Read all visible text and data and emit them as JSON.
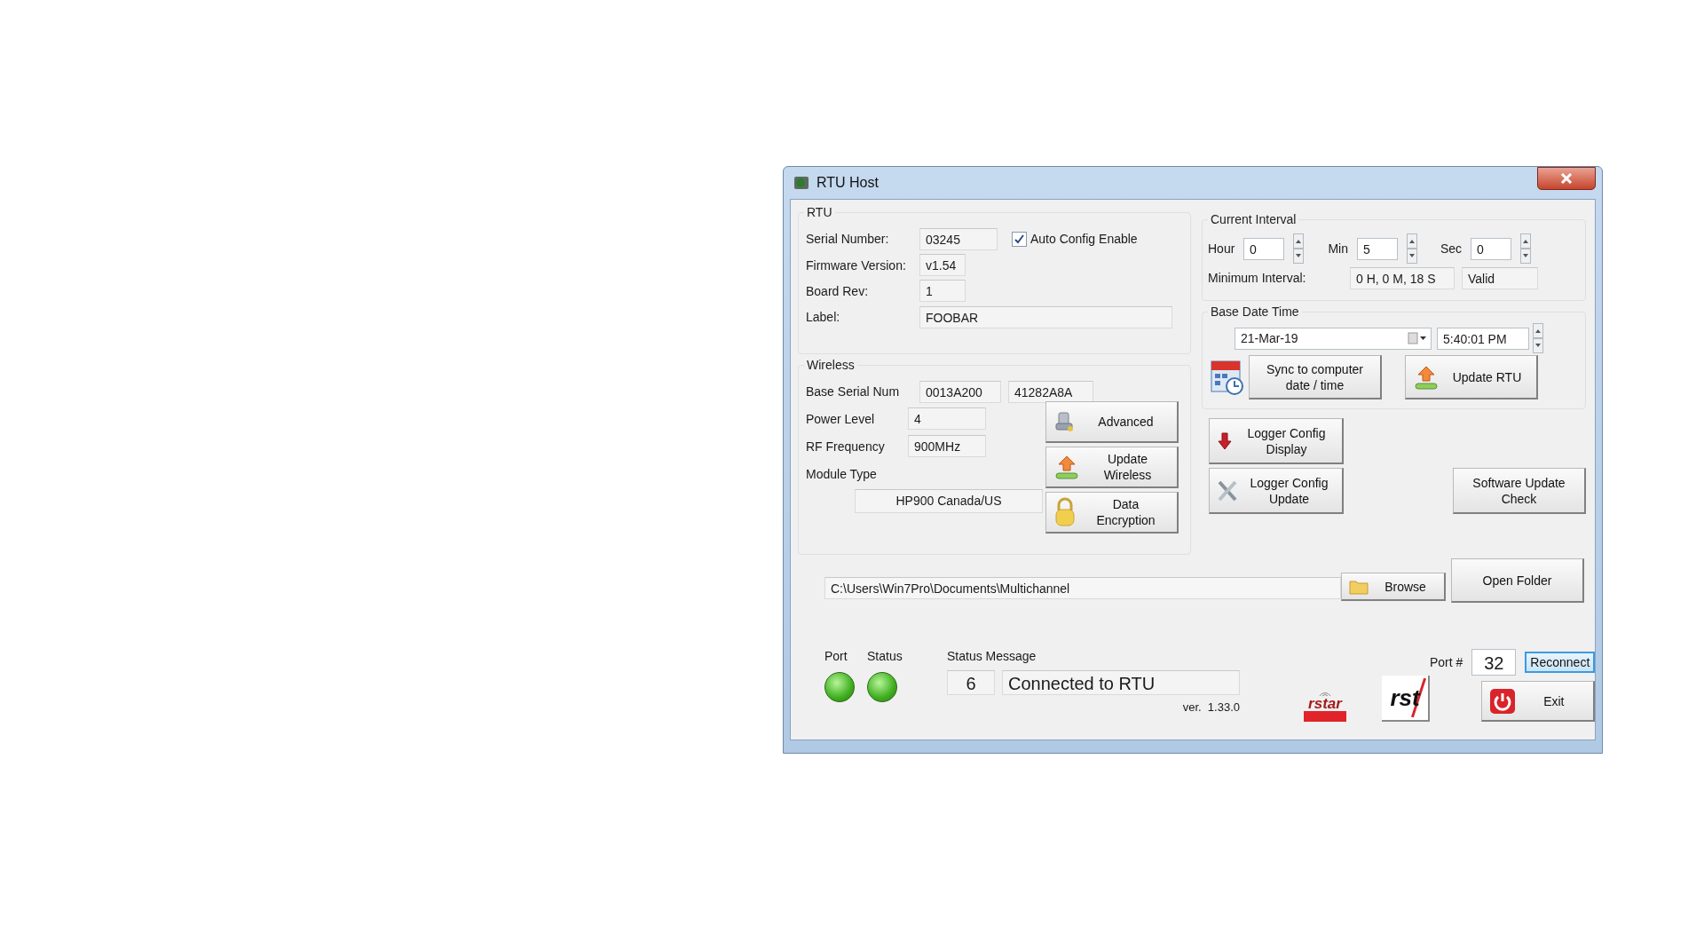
{
  "window": {
    "title": "RTU Host"
  },
  "rtu": {
    "title": "RTU",
    "serial_number": {
      "label": "Serial Number:",
      "value": "03245"
    },
    "auto_config": {
      "label": "Auto Config Enable",
      "checked": true
    },
    "firmware_version": {
      "label": "Firmware Version:",
      "value": "v1.54"
    },
    "board_rev": {
      "label": "Board Rev:",
      "value": "1"
    },
    "label": {
      "label": "Label:",
      "value": "FOOBAR"
    }
  },
  "wireless": {
    "title": "Wireless",
    "base_serial": {
      "label": "Base Serial Num",
      "values": [
        "0013A200",
        "41282A8A"
      ]
    },
    "power_level": {
      "label": "Power Level",
      "value": "4"
    },
    "rf_frequency": {
      "label": "RF Frequency",
      "value": "900MHz"
    },
    "module_type": {
      "label": "Module Type",
      "value": "HP900 Canada/US"
    },
    "buttons": [
      {
        "label": "Advanced"
      },
      {
        "label": "Update\nWireless"
      },
      {
        "label": "Data\nEncryption"
      }
    ]
  },
  "current_interval": {
    "title": "Current Interval",
    "fields": [
      {
        "label": "Hour",
        "value": "0"
      },
      {
        "label": "Min",
        "value": "5"
      },
      {
        "label": "Sec",
        "value": "0"
      }
    ],
    "minimum": {
      "label": "Minimum Interval:",
      "value": "0 H, 0 M, 18 S",
      "status": "Valid"
    }
  },
  "base_date_time": {
    "title": "Base Date Time",
    "date": "21-Mar-19",
    "time": "5:40:01 PM",
    "buttons": [
      {
        "label": "Sync to computer\ndate / time"
      },
      {
        "label": "Update RTU"
      }
    ]
  },
  "logger_buttons": [
    {
      "label": "Logger Config\nDisplay"
    },
    {
      "label": "Logger Config\nUpdate"
    }
  ],
  "software_update": {
    "label": "Software Update\nCheck"
  },
  "folder": {
    "path": "C:\\Users\\Win7Pro\\Documents\\Multichannel",
    "browse": "Browse",
    "open": "Open Folder"
  },
  "status": {
    "port_label": "Port",
    "status_label": "Status",
    "port_ok": true,
    "status_ok": true,
    "message_label": "Status Message",
    "code": "6",
    "message": "Connected to RTU",
    "version": "ver.  1.33.0"
  },
  "logos": [
    "rstar",
    "rst"
  ],
  "connection": {
    "port_label": "Port #",
    "port": "32",
    "reconnect": "Reconnect"
  },
  "exit": {
    "label": "Exit"
  }
}
